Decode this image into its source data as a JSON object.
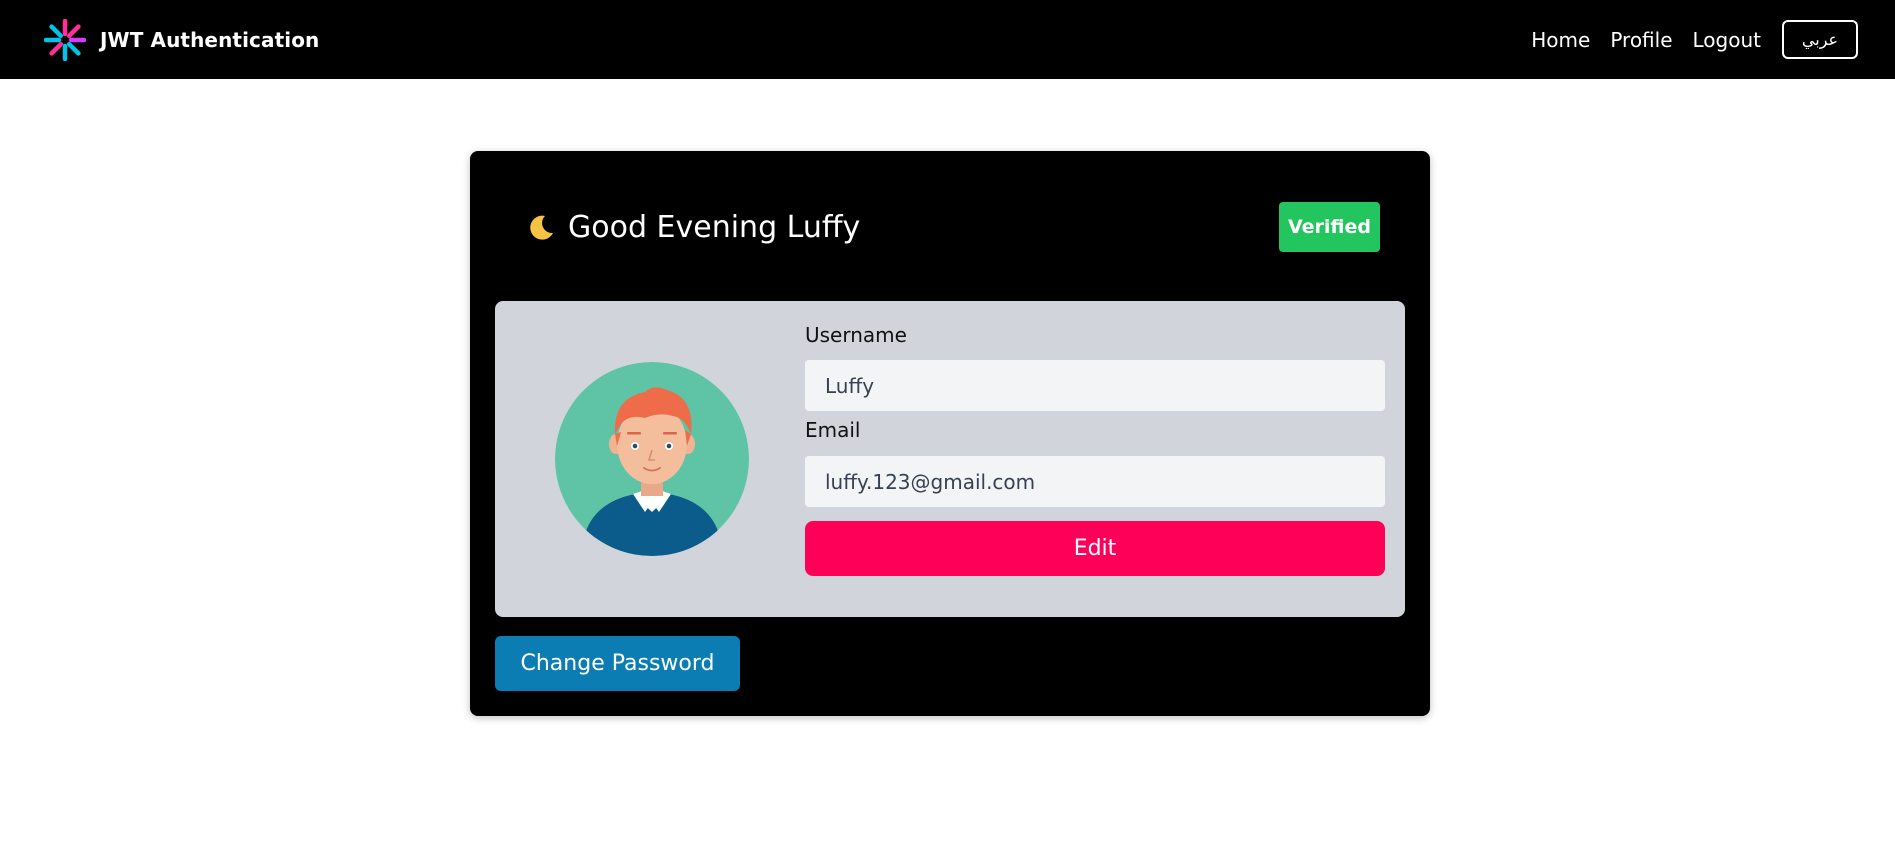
{
  "navbar": {
    "brand_logo_icon": "jwt-logo-icon",
    "brand_title": "JWT Authentication",
    "links": [
      "Home",
      "Profile",
      "Logout"
    ],
    "language_button": "عربي"
  },
  "profile": {
    "greeting_icon": "moon-icon",
    "greeting": "Good Evening Luffy",
    "status_badge": "Verified",
    "avatar_icon": "user-avatar-icon",
    "username_label": "Username",
    "username_value": "Luffy",
    "email_label": "Email",
    "email_value": "luffy.123@gmail.com",
    "edit_button": "Edit",
    "change_password_button": "Change Password"
  },
  "colors": {
    "navbar_bg": "#000000",
    "card_bg": "#000000",
    "panel_bg": "#d1d5db",
    "badge_green": "#22c55e",
    "edit_pink": "#ff0059",
    "change_password_blue": "#0b7db3"
  }
}
